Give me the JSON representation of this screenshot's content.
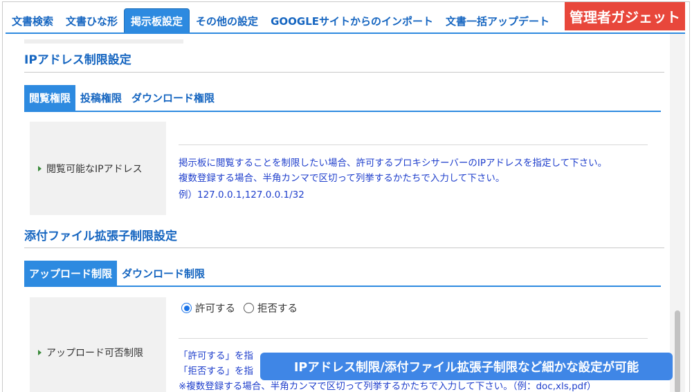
{
  "top_tabs": [
    {
      "label": "文書検索",
      "active": false
    },
    {
      "label": "文書ひな形",
      "active": false
    },
    {
      "label": "掲示板設定",
      "active": true
    },
    {
      "label": "その他の設定",
      "active": false
    },
    {
      "label": "GOOGLEサイトからのインポート",
      "active": false
    },
    {
      "label": "文書一括アップデート",
      "active": false
    }
  ],
  "admin_badge": "管理者ガジェット",
  "ip_section": {
    "title": "IPアドレス制限設定",
    "tabs": [
      {
        "label": "閲覧権限",
        "active": true
      },
      {
        "label": "投稿権限",
        "active": false
      },
      {
        "label": "ダウンロード権限",
        "active": false
      }
    ],
    "row_label": "閲覧可能なIPアドレス",
    "description": [
      "掲示板に閲覧することを制限したい場合、許可するプロキシサーバーのIPアドレスを指定して下さい。",
      "複数登録する場合、半角カンマで区切って列挙するかたちで入力して下さい。",
      "例）127.0.0.1,127.0.0.1/32"
    ]
  },
  "ext_section": {
    "title": "添付ファイル拡張子制限設定",
    "tabs": [
      {
        "label": "アップロード制限",
        "active": true
      },
      {
        "label": "ダウンロード制限",
        "active": false
      }
    ],
    "row_label": "アップロード可否制限",
    "radio_options": [
      {
        "label": "許可する",
        "checked": true
      },
      {
        "label": "拒否する",
        "checked": false
      }
    ],
    "description": [
      "「許可する」を指",
      "「拒否する」を指",
      "※複数登録する場合、半角カンマで区切って列挙するかたちで入力して下さい。（例：doc,xls,pdf）"
    ]
  },
  "banner_text": "IPアドレス制限/添付ファイル拡張子制限など細かな設定が可能",
  "colors": {
    "accent_blue": "#2d8ae0",
    "link_blue": "#1565c0",
    "admin_red": "#e8473b",
    "banner_blue": "#3f86e6"
  }
}
